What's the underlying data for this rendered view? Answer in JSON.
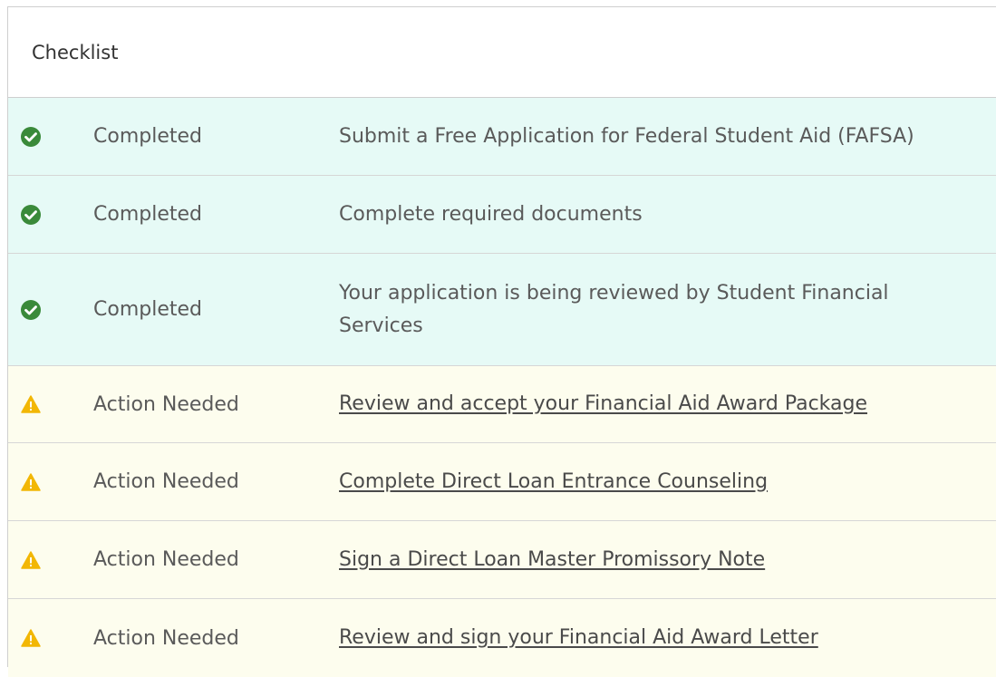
{
  "checklist": {
    "title": "Checklist",
    "colors": {
      "completed_bg": "#e6faf6",
      "action_bg": "#fdfdee",
      "check_green": "#3a8a3a",
      "warning_yellow": "#f2b705"
    },
    "items": [
      {
        "icon": "check-circle-icon",
        "status": "Completed",
        "text": "Submit a Free Application for Federal Student Aid (FAFSA)",
        "is_link": false
      },
      {
        "icon": "check-circle-icon",
        "status": "Completed",
        "text": "Complete required documents",
        "is_link": false
      },
      {
        "icon": "check-circle-icon",
        "status": "Completed",
        "text": "Your application is being reviewed by Student Financial Services",
        "is_link": false
      },
      {
        "icon": "warning-icon",
        "status": "Action Needed",
        "text": "Review and accept your Financial Aid Award Package",
        "is_link": true
      },
      {
        "icon": "warning-icon",
        "status": "Action Needed",
        "text": "Complete Direct Loan Entrance Counseling",
        "is_link": true
      },
      {
        "icon": "warning-icon",
        "status": "Action Needed",
        "text": "Sign a Direct Loan Master Promissory Note",
        "is_link": true
      },
      {
        "icon": "warning-icon",
        "status": "Action Needed",
        "text": "Review and sign your Financial Aid Award Letter",
        "is_link": true
      }
    ]
  }
}
